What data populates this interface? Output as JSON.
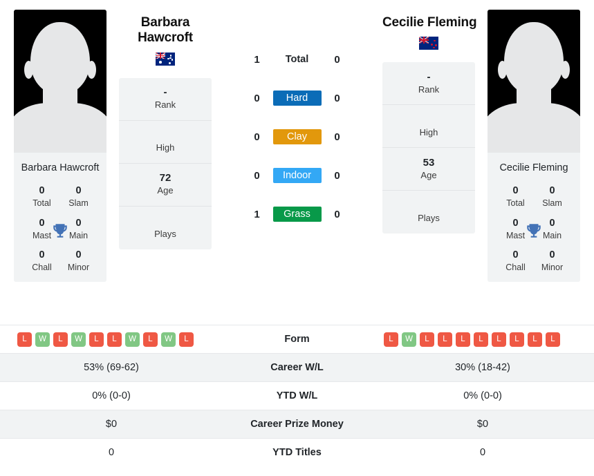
{
  "players": {
    "left": {
      "name": "Barbara Hawcroft",
      "name_line1": "Barbara",
      "name_line2": "Hawcroft",
      "caption": "Barbara Hawcroft",
      "country": "Australia",
      "flag": "australia-flag",
      "rank": "-",
      "rank_label": "Rank",
      "high": "",
      "high_label": "High",
      "age": "72",
      "age_label": "Age",
      "plays": "",
      "plays_label": "Plays",
      "titles": {
        "total": "0",
        "total_label": "Total",
        "slam": "0",
        "slam_label": "Slam",
        "mast": "0",
        "mast_label": "Mast",
        "main": "0",
        "main_label": "Main",
        "chall": "0",
        "chall_label": "Chall",
        "minor": "0",
        "minor_label": "Minor"
      },
      "form": [
        "L",
        "W",
        "L",
        "W",
        "L",
        "L",
        "W",
        "L",
        "W",
        "L"
      ],
      "career_wl": "53% (69-62)",
      "ytd_wl": "0% (0-0)",
      "career_prize_money": "$0",
      "ytd_titles": "0",
      "surface_counts": {
        "total": "1",
        "hard": "0",
        "clay": "0",
        "indoor": "0",
        "grass": "1"
      }
    },
    "right": {
      "name": "Cecilie Fleming",
      "name_line1": "Cecilie Fleming",
      "name_line2": "",
      "caption": "Cecilie Fleming",
      "country": "New Zealand",
      "flag": "new-zealand-flag",
      "rank": "-",
      "rank_label": "Rank",
      "high": "",
      "high_label": "High",
      "age": "53",
      "age_label": "Age",
      "plays": "",
      "plays_label": "Plays",
      "titles": {
        "total": "0",
        "total_label": "Total",
        "slam": "0",
        "slam_label": "Slam",
        "mast": "0",
        "mast_label": "Mast",
        "main": "0",
        "main_label": "Main",
        "chall": "0",
        "chall_label": "Chall",
        "minor": "0",
        "minor_label": "Minor"
      },
      "form": [
        "L",
        "W",
        "L",
        "L",
        "L",
        "L",
        "L",
        "L",
        "L",
        "L"
      ],
      "career_wl": "30% (18-42)",
      "ytd_wl": "0% (0-0)",
      "career_prize_money": "$0",
      "ytd_titles": "0",
      "surface_counts": {
        "total": "0",
        "hard": "0",
        "clay": "0",
        "indoor": "0",
        "grass": "0"
      }
    }
  },
  "surfaces": [
    {
      "key": "total",
      "label": "Total",
      "color": "transparent",
      "text_color": "#212529"
    },
    {
      "key": "hard",
      "label": "Hard",
      "color": "#0b6cb7",
      "text_color": "#ffffff"
    },
    {
      "key": "clay",
      "label": "Clay",
      "color": "#e2980c",
      "text_color": "#ffffff"
    },
    {
      "key": "indoor",
      "label": "Indoor",
      "color": "#33a8f5",
      "text_color": "#ffffff"
    },
    {
      "key": "grass",
      "label": "Grass",
      "color": "#089949",
      "text_color": "#ffffff"
    }
  ],
  "table": {
    "rows": [
      {
        "label": "Form",
        "left": "",
        "right": ""
      },
      {
        "label": "Career W/L",
        "left": "53% (69-62)",
        "right": "30% (18-42)"
      },
      {
        "label": "YTD W/L",
        "left": "0% (0-0)",
        "right": "0% (0-0)"
      },
      {
        "label": "Career Prize Money",
        "left": "$0",
        "right": "$0"
      },
      {
        "label": "YTD Titles",
        "left": "0",
        "right": "0"
      }
    ]
  },
  "colors": {
    "win": "#81c784",
    "loss": "#ef5844",
    "panel": "#f1f3f4",
    "trophy": "#4372b6"
  },
  "icons": {
    "trophy": "trophy-icon"
  }
}
